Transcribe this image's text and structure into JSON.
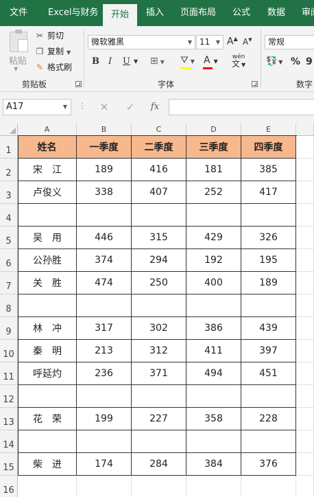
{
  "menu": {
    "tabs": [
      "文件",
      "Excel与财务",
      "开始",
      "插入",
      "页面布局",
      "公式",
      "数据",
      "审阅"
    ],
    "active": "开始"
  },
  "ribbon": {
    "clipboard": {
      "paste": "粘贴",
      "cut": "剪切",
      "copy": "复制",
      "format_painter": "格式刷",
      "label": "剪贴板"
    },
    "font": {
      "name": "微软雅黑",
      "size": "11",
      "label": "字体",
      "bold": "B",
      "italic": "I",
      "underline": "U",
      "font_color_letter": "A",
      "wen_glyph": "wén",
      "wen_char": "文",
      "grow_glyph": "A",
      "shrink_glyph": "A"
    },
    "number": {
      "format": "常规",
      "label": "数字",
      "percent": "%",
      "comma": "9"
    },
    "colors": {
      "fill": "#ffff00",
      "font": "#ff0000"
    }
  },
  "formula_bar": {
    "name_box": "A17",
    "cancel": "✕",
    "enter": "✓",
    "fx": "fx",
    "value": ""
  },
  "columns": [
    "A",
    "B",
    "C",
    "D",
    "E"
  ],
  "rows": [
    "1",
    "2",
    "3",
    "4",
    "5",
    "6",
    "7",
    "8",
    "9",
    "10",
    "11",
    "12",
    "13",
    "14",
    "15",
    "16"
  ],
  "table": {
    "header": [
      "姓名",
      "一季度",
      "二季度",
      "三季度",
      "四季度"
    ],
    "header_color": "#f8b88d",
    "data": [
      [
        "宋　江",
        "189",
        "416",
        "181",
        "385"
      ],
      [
        "卢俊义",
        "338",
        "407",
        "252",
        "417"
      ],
      [
        "",
        "",
        "",
        "",
        ""
      ],
      [
        "吴　用",
        "446",
        "315",
        "429",
        "326"
      ],
      [
        "公孙胜",
        "374",
        "294",
        "192",
        "195"
      ],
      [
        "关　胜",
        "474",
        "250",
        "400",
        "189"
      ],
      [
        "",
        "",
        "",
        "",
        ""
      ],
      [
        "林　冲",
        "317",
        "302",
        "386",
        "439"
      ],
      [
        "秦　明",
        "213",
        "312",
        "411",
        "397"
      ],
      [
        "呼延灼",
        "236",
        "371",
        "494",
        "451"
      ],
      [
        "",
        "",
        "",
        "",
        ""
      ],
      [
        "花　荣",
        "199",
        "227",
        "358",
        "228"
      ],
      [
        "",
        "",
        "",
        "",
        ""
      ],
      [
        "柴　进",
        "174",
        "284",
        "384",
        "376"
      ]
    ]
  }
}
